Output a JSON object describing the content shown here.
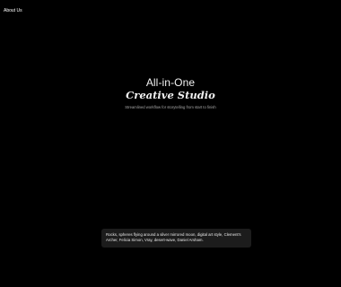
{
  "nav": {
    "about_label": "About Us"
  },
  "hero": {
    "line1": "All-in-One",
    "line2": "Creative Studio",
    "subtitle": "Streamlined workflow for storytelling from start to finish"
  },
  "prompt": {
    "text": "Rocks, spheres flying around a silver mirrored moon, digital art style, Clement's Archer, Felicia Simon, Vray, desert-wave, Daniel Arsham."
  },
  "colors": {
    "background": "#000000",
    "text": "#ffffff",
    "muted_text": "#a8a8a8",
    "card_background": "#1c1c1c"
  }
}
